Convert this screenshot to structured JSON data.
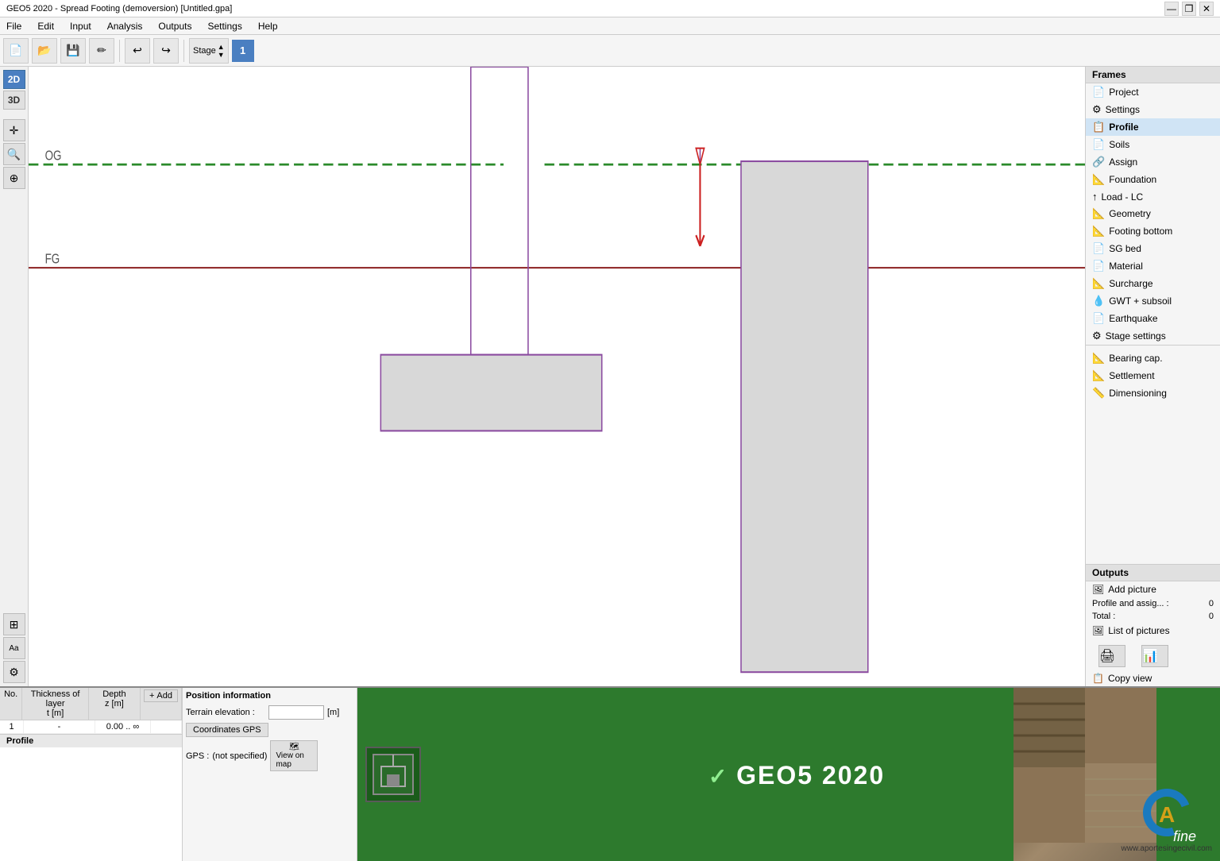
{
  "titlebar": {
    "title": "GEO5 2020 - Spread Footing (demoversion) [Untitled.gpa]",
    "controls": [
      "—",
      "❐",
      "✕"
    ]
  },
  "menubar": {
    "items": [
      "File",
      "Edit",
      "Input",
      "Analysis",
      "Outputs",
      "Settings",
      "Help"
    ]
  },
  "toolbar": {
    "new_title": "New",
    "open_title": "Open",
    "save_title": "Save",
    "edit_title": "Edit",
    "undo_title": "Undo",
    "redo_title": "Redo",
    "stage_label": "Stage",
    "stage_number": "1"
  },
  "left_panel": {
    "buttons": [
      {
        "name": "2d-view-btn",
        "label": "2D"
      },
      {
        "name": "3d-view-btn",
        "label": "3D"
      },
      {
        "name": "move-btn",
        "label": "✛"
      },
      {
        "name": "zoom-btn",
        "label": "🔍"
      },
      {
        "name": "info-btn",
        "label": "⊕"
      },
      {
        "name": "grid-btn",
        "label": "⊞"
      },
      {
        "name": "label-btn",
        "label": "Aa"
      },
      {
        "name": "settings-btn",
        "label": "⚙"
      }
    ]
  },
  "canvas": {
    "label_og": "OG",
    "label_fg": "FG"
  },
  "right_panel": {
    "frames_header": "Frames",
    "items": [
      {
        "name": "project",
        "label": "Project",
        "icon": "📄",
        "active": false
      },
      {
        "name": "settings",
        "label": "Settings",
        "icon": "⚙",
        "active": false
      },
      {
        "name": "profile",
        "label": "Profile",
        "icon": "📋",
        "active": true
      },
      {
        "name": "soils",
        "label": "Soils",
        "icon": "📄",
        "active": false
      },
      {
        "name": "assign",
        "label": "Assign",
        "icon": "🔗",
        "active": false
      },
      {
        "name": "foundation",
        "label": "Foundation",
        "icon": "📐",
        "active": false
      },
      {
        "name": "load-lc",
        "label": "Load - LC",
        "icon": "↑",
        "active": false
      },
      {
        "name": "geometry",
        "label": "Geometry",
        "icon": "📐",
        "active": false
      },
      {
        "name": "footing-bottom",
        "label": "Footing bottom",
        "icon": "📐",
        "active": false
      },
      {
        "name": "sg-bed",
        "label": "SG bed",
        "icon": "📄",
        "active": false
      },
      {
        "name": "material",
        "label": "Material",
        "icon": "📄",
        "active": false
      },
      {
        "name": "surcharge",
        "label": "Surcharge",
        "icon": "📐",
        "active": false
      },
      {
        "name": "gwt-subsoil",
        "label": "GWT + subsoil",
        "icon": "💧",
        "active": false
      },
      {
        "name": "earthquake",
        "label": "Earthquake",
        "icon": "📄",
        "active": false
      },
      {
        "name": "stage-settings",
        "label": "Stage settings",
        "icon": "⚙",
        "active": false
      },
      {
        "name": "bearing-cap",
        "label": "Bearing cap.",
        "icon": "📐",
        "active": false
      },
      {
        "name": "settlement",
        "label": "Settlement",
        "icon": "📐",
        "active": false
      },
      {
        "name": "dimensioning",
        "label": "Dimensioning",
        "icon": "📏",
        "active": false
      }
    ],
    "outputs_header": "Outputs",
    "add_picture_label": "Add picture",
    "profile_assign_label": "Profile and assig... :",
    "profile_assign_value": "0",
    "total_label": "Total :",
    "total_value": "0",
    "list_pictures_label": "List of pictures",
    "copy_view_label": "Copy view"
  },
  "bottom_panel": {
    "table": {
      "col_no": "No.",
      "col_thickness": "Thickness of layer\nt [m]",
      "col_depth": "Depth\nz [m]",
      "add_label": "Add",
      "rows": [
        {
          "no": "1",
          "thickness": "-",
          "depth": "0.00 .. ∞"
        }
      ],
      "footer_label": "Profile"
    },
    "position_info": {
      "header": "Position information",
      "terrain_label": "Terrain elevation :",
      "terrain_unit": "[m]",
      "terrain_value": "",
      "gps_btn": "Coordinates GPS",
      "gps_label": "GPS :",
      "gps_value": "(not specified)",
      "view_map_label": "View\non map"
    },
    "banner": {
      "logo_icon": "⊞",
      "text_part1": "GEO5",
      "text_part2": "2020",
      "fine_label": "fine"
    },
    "watermark": {
      "url": "www.aportesingecivil.com"
    }
  }
}
